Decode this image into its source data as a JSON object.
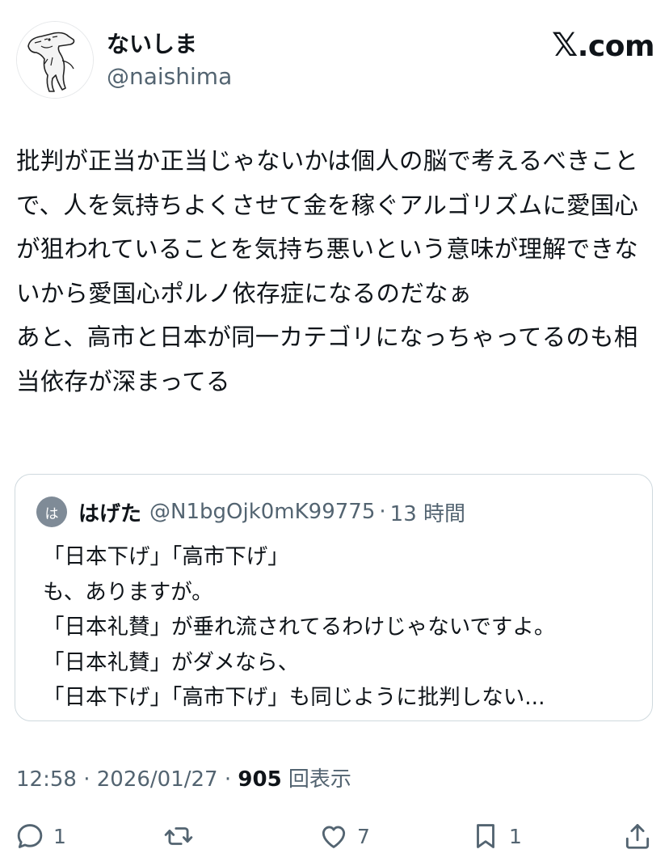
{
  "author": {
    "display_name": "ないしま",
    "handle": "@naishima"
  },
  "brand": {
    "icon": "x-logo-icon",
    "text": ".com"
  },
  "tweet": {
    "text": "批判が正当か正当じゃないかは個人の脳で考えるべきことで、人を気持ちよくさせて金を稼ぐアルゴリズムに愛国心が狙われていることを気持ち悪いという意味が理解できないから愛国心ポルノ依存症になるのだなぁ\nあと、高市と日本が同一カテゴリになっちゃってるのも相当依存が深まってる"
  },
  "quote": {
    "avatar_letter": "は",
    "display_name": "はげた",
    "handle": "@N1bgOjk0mK99775",
    "separator": "·",
    "time": "13 時間",
    "text": "「日本下げ」「高市下げ」\nも、ありますが。\n「日本礼賛」が垂れ流されてるわけじゃないですよ。\n「日本礼賛」がダメなら、\n「日本下げ」「高市下げ」も同じように批判しない..."
  },
  "meta": {
    "time": "12:58",
    "sep1": " · ",
    "date": "2026/01/27",
    "sep2": " · ",
    "views": "905",
    "views_label": " 回表示"
  },
  "actions": {
    "reply": {
      "icon": "reply-icon",
      "count": "1"
    },
    "retweet": {
      "icon": "retweet-icon",
      "count": ""
    },
    "like": {
      "icon": "heart-icon",
      "count": "7"
    },
    "bookmark": {
      "icon": "bookmark-icon",
      "count": "1"
    },
    "share": {
      "icon": "share-icon",
      "count": ""
    }
  },
  "colors": {
    "text_primary": "#0f1419",
    "text_secondary": "#536471",
    "border": "#cfd9de",
    "quote_avatar_bg": "#7f8b97"
  }
}
